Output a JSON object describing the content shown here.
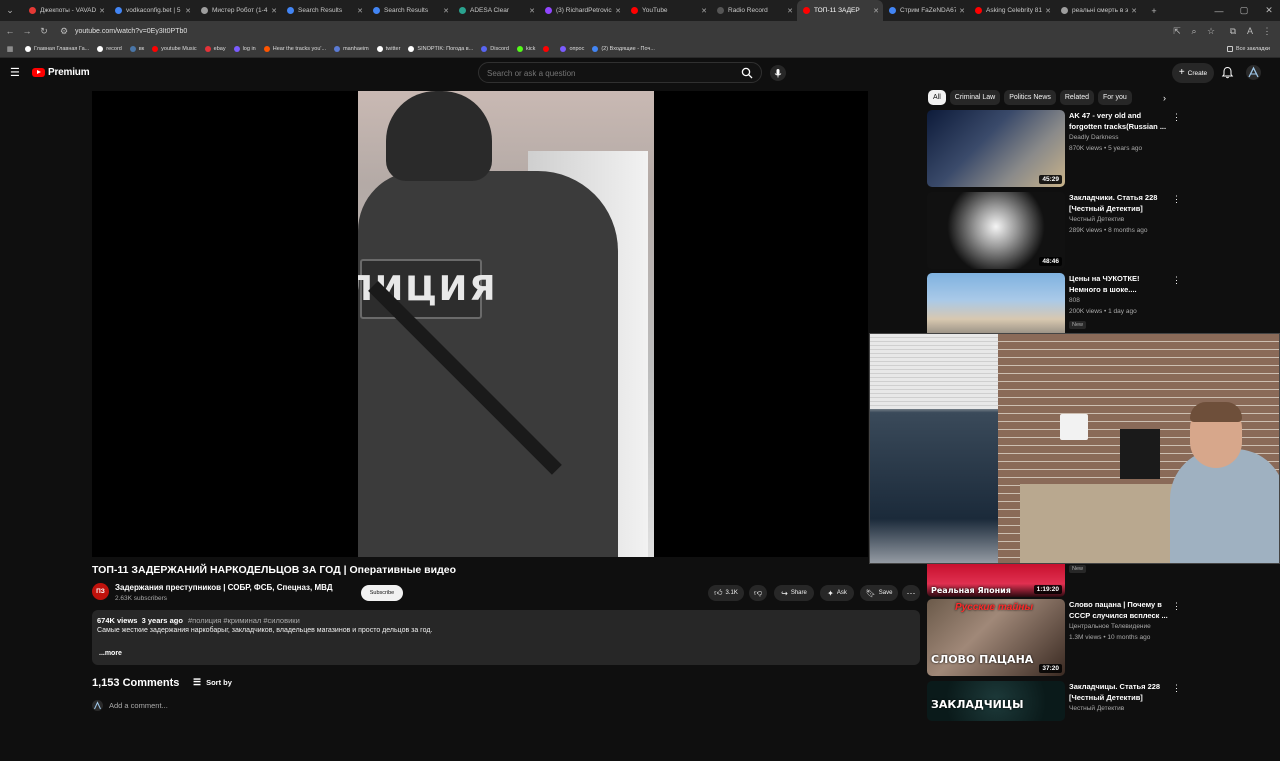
{
  "browser": {
    "tabs": [
      {
        "title": "Джекпоты - VAVAD",
        "color": "#e53935",
        "active": false
      },
      {
        "title": "vodkaconfig.bet | 5",
        "color": "#4285f4",
        "active": false
      },
      {
        "title": "Мистер Робот (1-4",
        "color": "#9e9e9e",
        "active": false
      },
      {
        "title": "Search Results",
        "color": "#4285f4",
        "active": false
      },
      {
        "title": "Search Results",
        "color": "#4285f4",
        "active": false
      },
      {
        "title": "ADESA Clear",
        "color": "#2aa38f",
        "active": false
      },
      {
        "title": "(3) RichardPetrovic",
        "color": "#9146ff",
        "active": false
      },
      {
        "title": "YouTube",
        "color": "#ff0000",
        "active": false
      },
      {
        "title": "Radio Record",
        "color": "#555555",
        "active": false
      },
      {
        "title": "ТОП-11 ЗАДЕР",
        "color": "#ff0000",
        "active": true
      },
      {
        "title": "Стрим FaZeNDA67",
        "color": "#4285f4",
        "active": false
      },
      {
        "title": "Asking Celebrity 81",
        "color": "#ff0000",
        "active": false
      },
      {
        "title": "реальні смерть в э",
        "color": "#9e9e9e",
        "active": false
      }
    ],
    "url": "youtube.com/watch?v=0Ey3It0PTb0",
    "bookmarks": [
      {
        "label": "Главная Главная Га...",
        "color": "#ffffff"
      },
      {
        "label": "record",
        "color": "#ffffff"
      },
      {
        "label": "вк",
        "color": "#4a76a8"
      },
      {
        "label": "youtube Music",
        "color": "#ff0000"
      },
      {
        "label": "ebay",
        "color": "#e53238"
      },
      {
        "label": "log in",
        "color": "#7b5cff"
      },
      {
        "label": "Hear the tracks you'...",
        "color": "#ff5500"
      },
      {
        "label": "manhaeim",
        "color": "#5b7bd5"
      },
      {
        "label": "twitter",
        "color": "#ffffff"
      },
      {
        "label": "SINOPTIK: Погода в...",
        "color": "#ffffff"
      },
      {
        "label": "Discord",
        "color": "#5865f2"
      },
      {
        "label": "kick",
        "color": "#53fc18"
      },
      {
        "label": "",
        "color": "#ff0000"
      },
      {
        "label": "опрос",
        "color": "#7b5cff"
      },
      {
        "label": "(2) Входящие - Поч...",
        "color": "#4285f4"
      }
    ],
    "bookmarks_all": "Все закладки"
  },
  "header": {
    "logo_text": "Premium",
    "search_placeholder": "Search or ask a question",
    "create_label": "Create"
  },
  "video": {
    "patch_text": "ЛИЦИЯ",
    "title": "ТОП-11 ЗАДЕРЖАНИЙ НАРКОДЕЛЬЦОВ ЗА ГОД | Оперативные видео",
    "channel_avatar": "ПЗ",
    "channel_name": "Задержания преступников | СОБР, ФСБ, Спецназ, МВД",
    "subscribers": "2.63K subscribers",
    "subscribe_label": "Subscribe",
    "likes": "3.1K",
    "share_label": "Share",
    "ask_label": "Ask",
    "save_label": "Save"
  },
  "description": {
    "views": "674K views",
    "age": "3 years ago",
    "tags": "#полиция #криминал #силовики",
    "text": "Самые жесткие задержания наркобарыг, закладчиков, владельцев магазинов и просто дельцов за год.",
    "more": "...more"
  },
  "comments": {
    "count": "1,153 Comments",
    "sort_label": "Sort by",
    "add_placeholder": "Add a comment..."
  },
  "sidebar": {
    "chips": [
      "All",
      "Criminal Law",
      "Politics News",
      "Related",
      "For you"
    ],
    "recs": [
      {
        "title": "AK 47 - very old and forgotten tracks(Russian ...",
        "channel": "Deadly Darkness",
        "views": "870K views • 5 years ago",
        "duration": "45:29",
        "new": "",
        "thumb": "linear-gradient(135deg,#0d1b3a 0%,#3a4a6a 40%,#8a8a8a 70%,#c9b38a 100%)"
      },
      {
        "title": "Закладчики. Статья 228 [Честный Детектив]",
        "channel": "Честный Детектив",
        "views": "289K views • 8 months ago",
        "duration": "48:46",
        "new": "",
        "thumb": "radial-gradient(circle at 50% 45%,#f5f5f5 0%,#9a9a9a 25%,#111 60%)"
      },
      {
        "title": "Цены на ЧУКОТКЕ! Немного в шоке....",
        "channel": "808",
        "views": "200K views • 1 day ago",
        "duration": "",
        "new": "New",
        "thumb": "linear-gradient(180deg,#7fb2e0 0%,#a9c9e8 35%,#d8c8b0 60%,#555 100%)"
      },
      {
        "title": "",
        "channel": "",
        "views": "",
        "duration": "1:19:20",
        "new": "New",
        "thumb": "linear-gradient(180deg,#c8102e 0%,#e03050 60%,#2a0a10 100%)",
        "caption": "Реальная Япония"
      },
      {
        "title": "Слово пацана | Почему в СССР случился всплеск ...",
        "channel": "Центральное Телевидение",
        "views": "1.3M views • 10 months ago",
        "duration": "37:20",
        "new": "",
        "thumb": "linear-gradient(135deg,#6b5a4a 0%,#a08878 40%,#3a2a22 100%)",
        "caption": "СЛОВО ПАЦАНА",
        "badge": "Русские тайны"
      },
      {
        "title": "Закладчицы. Статья 228 [Честный Детектив]",
        "channel": "Честный Детектив",
        "views": "",
        "duration": "",
        "new": "",
        "thumb": "radial-gradient(circle at 50% 50%,#1d3a3a 0%,#0a1a1a 70%)",
        "caption": "ЗАКЛАДЧИЦЫ"
      }
    ]
  },
  "colors": {
    "youtube_red": "#ff0000",
    "bg": "#0f0f0f",
    "pill": "#272727"
  }
}
